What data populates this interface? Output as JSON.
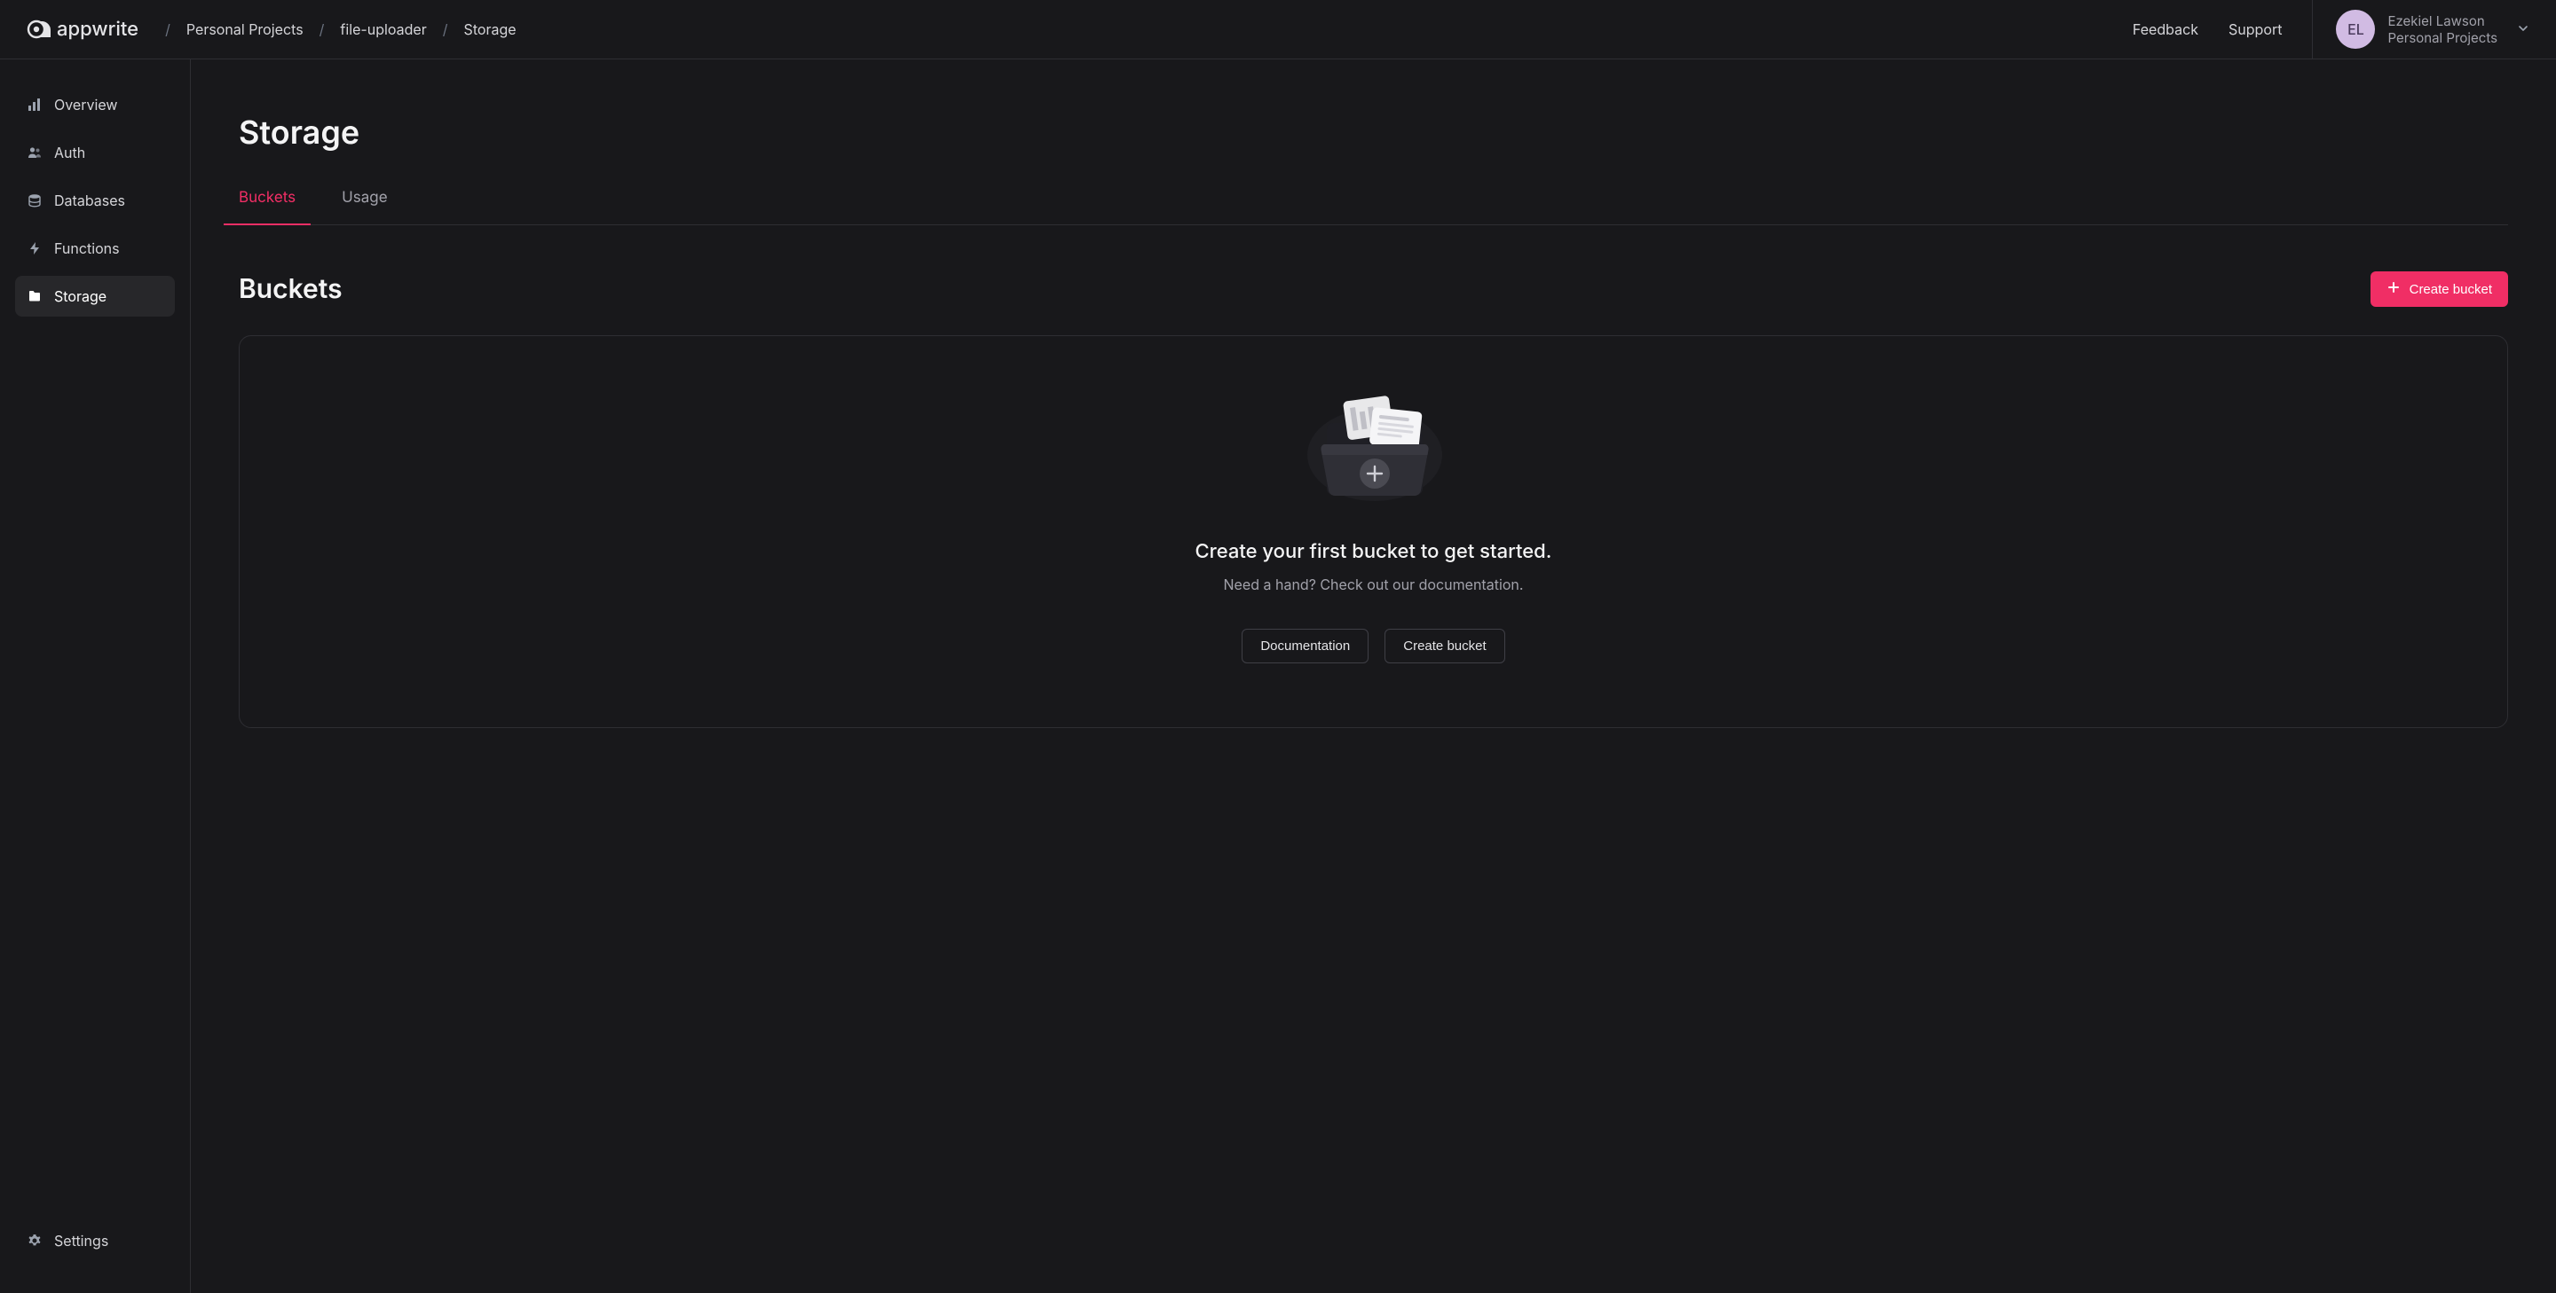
{
  "logo": {
    "text": "appwrite"
  },
  "breadcrumb": {
    "sep": "/",
    "items": [
      "Personal Projects",
      "file-uploader",
      "Storage"
    ]
  },
  "header": {
    "feedback": "Feedback",
    "support": "Support"
  },
  "user": {
    "initials": "EL",
    "name": "Ezekiel Lawson",
    "org": "Personal Projects"
  },
  "sidebar": {
    "items": [
      {
        "label": "Overview"
      },
      {
        "label": "Auth"
      },
      {
        "label": "Databases"
      },
      {
        "label": "Functions"
      },
      {
        "label": "Storage"
      }
    ],
    "settings": "Settings"
  },
  "main": {
    "page_title": "Storage",
    "tabs": {
      "buckets": "Buckets",
      "usage": "Usage"
    },
    "section_title": "Buckets",
    "create_bucket": "Create bucket",
    "empty": {
      "title": "Create your first bucket to get started.",
      "subtitle": "Need a hand? Check out our documentation.",
      "documentation": "Documentation",
      "create": "Create bucket"
    }
  }
}
